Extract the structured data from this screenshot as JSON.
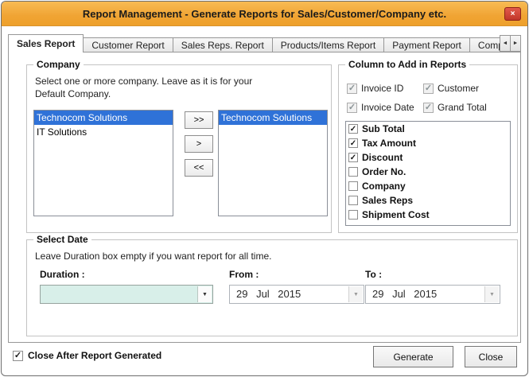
{
  "window": {
    "title": "Report Management - Generate Reports for Sales/Customer/Company etc.",
    "close_glyph": "×"
  },
  "tab_scroll": {
    "left_glyph": "◄",
    "right_glyph": "►"
  },
  "tabs": [
    {
      "label": "Sales Report",
      "active": true
    },
    {
      "label": "Customer Report",
      "active": false
    },
    {
      "label": "Sales Reps. Report",
      "active": false
    },
    {
      "label": "Products/Items Report",
      "active": false
    },
    {
      "label": "Payment Report",
      "active": false
    },
    {
      "label": "Company",
      "active": false
    }
  ],
  "company_group": {
    "title": "Company",
    "description": "Select one or more company. Leave as it is for your Default Company.",
    "available": [
      {
        "label": "Technocom Solutions",
        "selected": true
      },
      {
        "label": "IT Solutions",
        "selected": false
      }
    ],
    "chosen": [
      {
        "label": "Technocom Solutions",
        "selected": true
      }
    ],
    "move_all_right": ">>",
    "move_right": ">",
    "move_all_left": "<<"
  },
  "columns_group": {
    "title": "Column to Add in Reports",
    "fixed": [
      {
        "label": "Invoice ID",
        "mark": "✓",
        "disabled": true
      },
      {
        "label": "Customer",
        "mark": "✓",
        "disabled": true
      },
      {
        "label": "Invoice Date",
        "mark": "✓",
        "disabled": true
      },
      {
        "label": "Grand Total",
        "mark": "✓",
        "disabled": true
      }
    ],
    "optional": [
      {
        "label": "Sub Total",
        "mark": "✓"
      },
      {
        "label": "Tax Amount",
        "mark": "✓"
      },
      {
        "label": "Discount",
        "mark": "✓"
      },
      {
        "label": "Order No.",
        "mark": ""
      },
      {
        "label": "Company",
        "mark": ""
      },
      {
        "label": "Sales Reps",
        "mark": ""
      },
      {
        "label": "Shipment Cost",
        "mark": ""
      }
    ]
  },
  "date_group": {
    "title": "Select Date",
    "description": "Leave Duration box empty if you want report for all time.",
    "duration_label": "Duration :",
    "duration_value": "",
    "from_label": "From :",
    "from_value": "29 Jul 2015",
    "to_label": "To :",
    "to_value": "29 Jul 2015",
    "dropdown_glyph": "▼"
  },
  "footer": {
    "close_after_label": "Close After Report Generated",
    "close_after_mark": "✓",
    "close_after_checked": true,
    "generate_label": "Generate",
    "close_label": "Close"
  },
  "colors": {
    "titlebar": "#F0A433",
    "close_button": "#C1372A",
    "selection": "#2F72D8",
    "duration_combo_bg": "#D8EFE9"
  }
}
